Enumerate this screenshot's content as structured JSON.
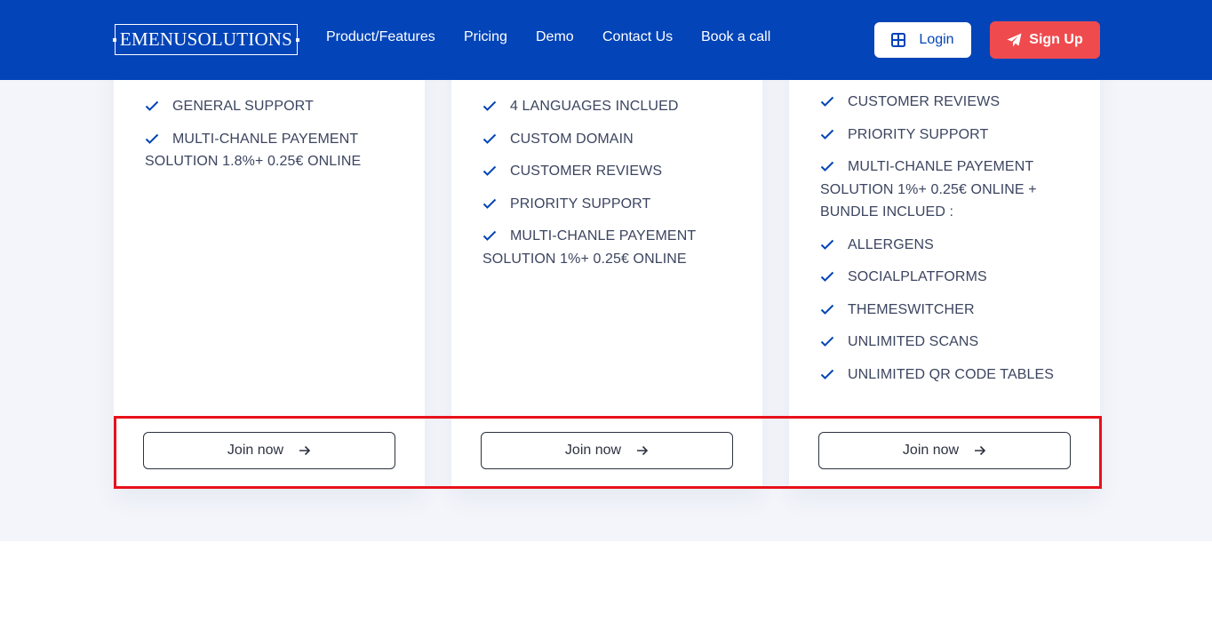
{
  "header": {
    "logo_text": "EMENUSOLUTIONS",
    "nav": [
      "Product/Features",
      "Pricing",
      "Demo",
      "Contact Us",
      "Book a call"
    ],
    "login_label": "Login",
    "signup_label": "Sign Up"
  },
  "plans": [
    {
      "features": [
        "GENERAL SUPPORT",
        "MULTI-CHANLE PAYEMENT SOLUTION 1.8%+ 0.25€ ONLINE"
      ],
      "cta": "Join now"
    },
    {
      "features": [
        "4 LANGUAGES INCLUED",
        "CUSTOM DOMAIN",
        "CUSTOMER REVIEWS",
        "PRIORITY SUPPORT",
        "MULTI-CHANLE PAYEMENT SOLUTION 1%+ 0.25€ ONLINE"
      ],
      "cta": "Join now"
    },
    {
      "features": [
        "CUSTOMER REVIEWS",
        "PRIORITY SUPPORT",
        "MULTI-CHANLE PAYEMENT SOLUTION 1%+ 0.25€ ONLINE + BUNDLE INCLUED :",
        "ALLERGENS",
        "SOCIALPLATFORMS",
        "THEMESWITCHER",
        "UNLIMITED SCANS",
        "UNLIMITED QR CODE TABLES"
      ],
      "cta": "Join now"
    }
  ],
  "icons": {
    "check": "check-icon",
    "arrow": "arrow-right-icon",
    "login": "grid-icon",
    "signup": "paper-plane-icon"
  },
  "colors": {
    "header_bg": "#0344b8",
    "accent_blue": "#0344b8",
    "signup_bg": "#ef4b4e",
    "section_bg": "#f3f5fa",
    "highlight": "#e8111b"
  }
}
